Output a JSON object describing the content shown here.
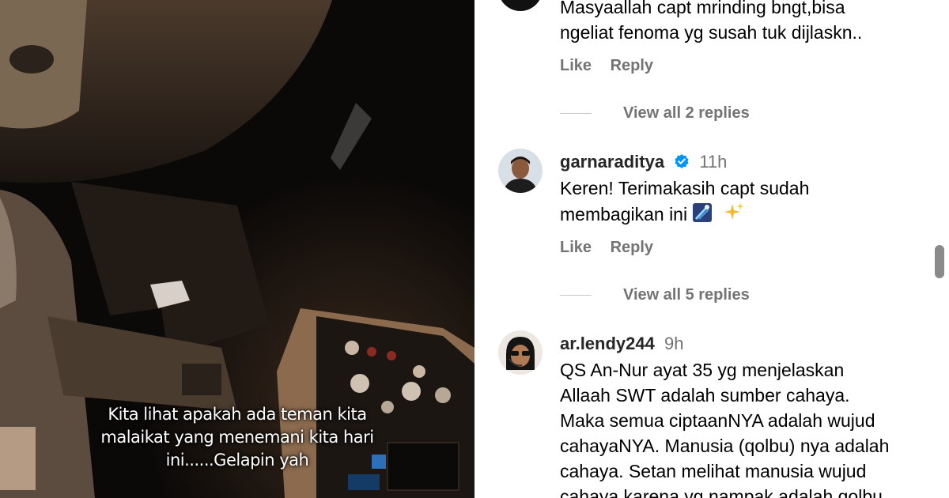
{
  "video": {
    "caption_lines": [
      "Kita lihat apakah ada teman kita",
      "malaikat yang menemani kita hari",
      "ini......Gelapin yah"
    ]
  },
  "comments": [
    {
      "username": "",
      "time": "",
      "text_lines": [
        "Masyaallah capt mrinding bngt,bisa",
        "ngeliat fenoma yg susah tuk dijlaskn.."
      ],
      "like_label": "Like",
      "reply_label": "Reply",
      "view_replies_label": "View all 2 replies"
    },
    {
      "username": "garnaraditya",
      "verified": true,
      "time": "11h",
      "text_lines": [
        "Keren! Terimakasih capt sudah",
        "membagikan ini"
      ],
      "emojis": [
        "comet-emoji",
        "sparkles-emoji"
      ],
      "like_label": "Like",
      "reply_label": "Reply",
      "view_replies_label": "View all 5 replies"
    },
    {
      "username": "ar.lendy244",
      "time": "9h",
      "text_lines": [
        "QS An-Nur ayat 35 yg menjelaskan",
        "Allaah SWT adalah sumber cahaya.",
        "Maka semua ciptaanNYA adalah wujud",
        "cahayaNYA. Manusia (qolbu) nya adalah",
        "cahaya. Setan melihat manusia wujud",
        "cahaya karena yg nampak adalah qolbu"
      ]
    }
  ],
  "colors": {
    "secondary_text": "#737373",
    "verified_badge": "#0095f6",
    "scrollbar_thumb": "#8a8a8a"
  }
}
